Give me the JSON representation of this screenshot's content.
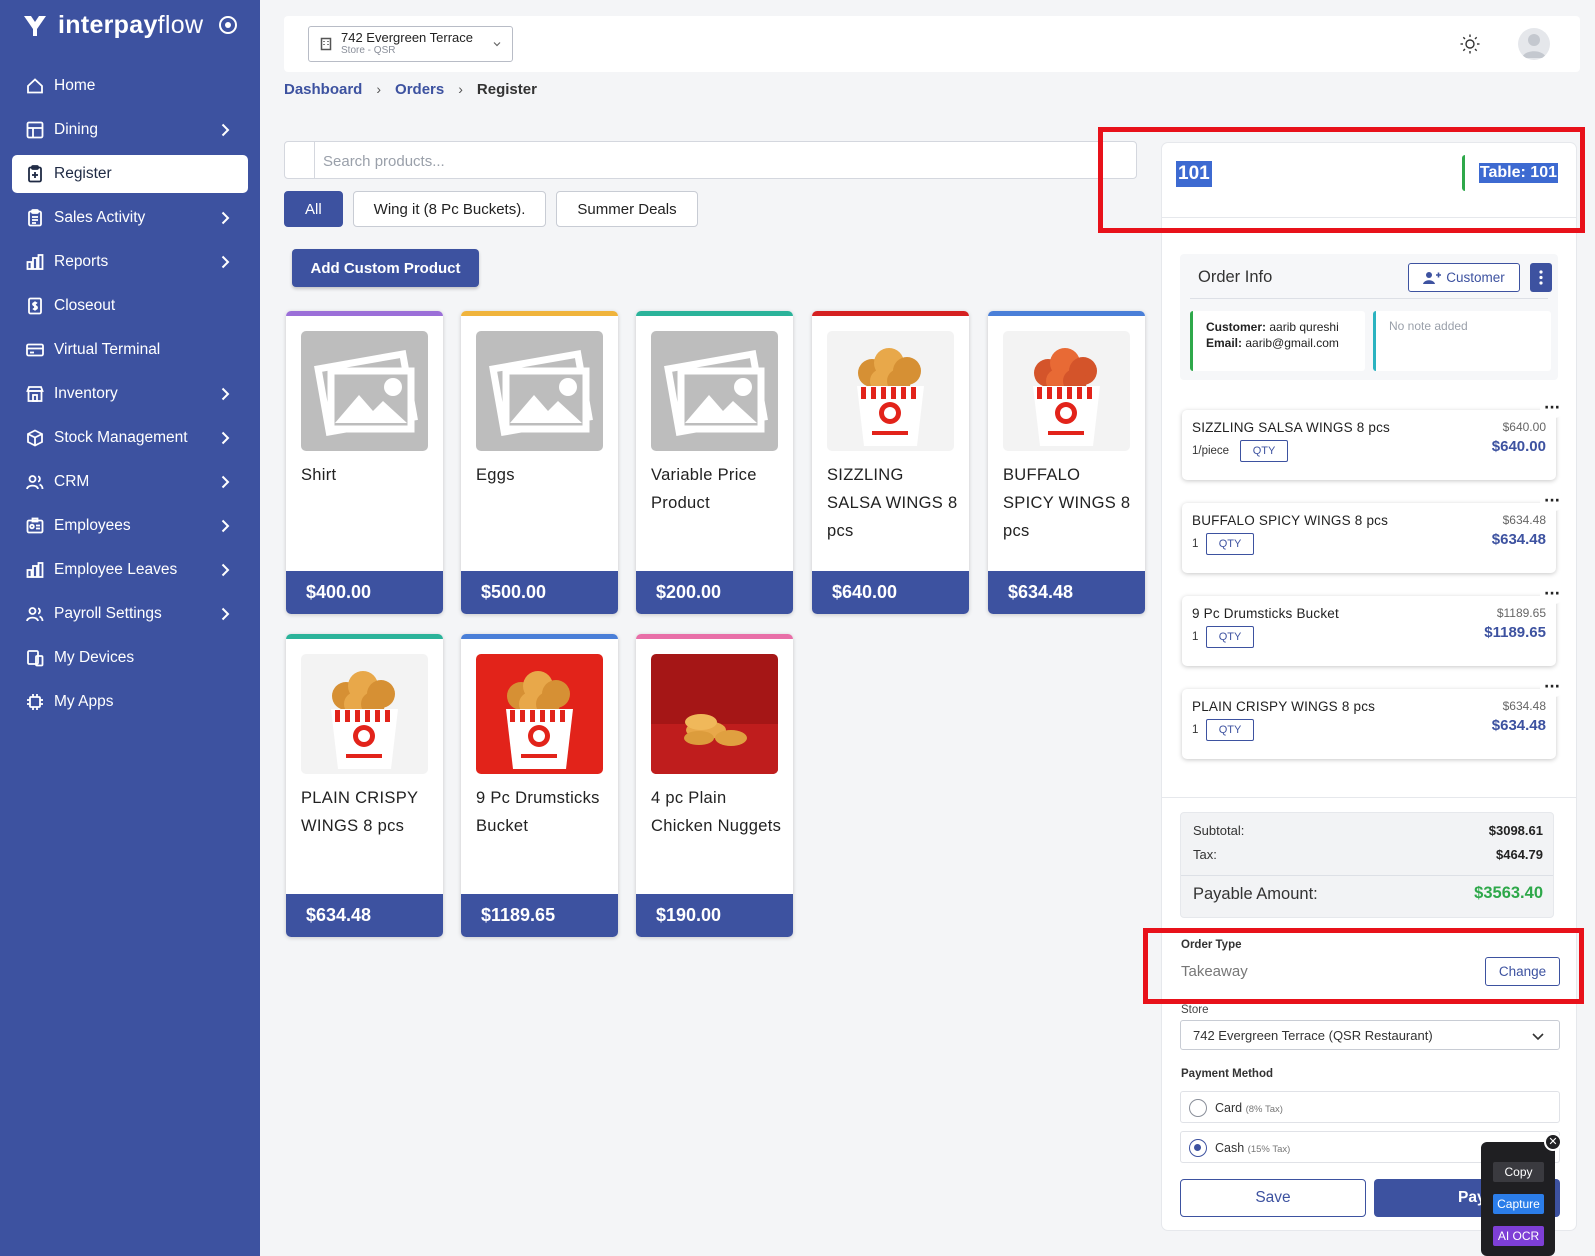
{
  "brand": {
    "name_bold": "interpay",
    "name_light": "flow"
  },
  "sidebar": {
    "items": [
      {
        "label": "Home",
        "icon": "home-icon",
        "has_chevron": false
      },
      {
        "label": "Dining",
        "icon": "table-icon",
        "has_chevron": true
      },
      {
        "label": "Register",
        "icon": "clipboard-icon",
        "has_chevron": false,
        "active": true
      },
      {
        "label": "Sales Activity",
        "icon": "clipboard-list-icon",
        "has_chevron": true
      },
      {
        "label": "Reports",
        "icon": "bar-chart-icon",
        "has_chevron": true
      },
      {
        "label": "Closeout",
        "icon": "dollar-file-icon",
        "has_chevron": false
      },
      {
        "label": "Virtual Terminal",
        "icon": "credit-card-icon",
        "has_chevron": false
      },
      {
        "label": "Inventory",
        "icon": "store-icon",
        "has_chevron": true
      },
      {
        "label": "Stock Management",
        "icon": "box-icon",
        "has_chevron": true
      },
      {
        "label": "CRM",
        "icon": "users-icon",
        "has_chevron": true
      },
      {
        "label": "Employees",
        "icon": "id-card-icon",
        "has_chevron": true
      },
      {
        "label": "Employee Leaves",
        "icon": "bar-chart-icon",
        "has_chevron": true
      },
      {
        "label": "Payroll Settings",
        "icon": "users-icon",
        "has_chevron": true
      },
      {
        "label": "My Devices",
        "icon": "devices-icon",
        "has_chevron": false
      },
      {
        "label": "My Apps",
        "icon": "chip-icon",
        "has_chevron": false
      }
    ]
  },
  "topbar": {
    "store_name": "742 Evergreen Terrace",
    "store_type": "Store - QSR"
  },
  "breadcrumb": {
    "dashboard": "Dashboard",
    "orders": "Orders",
    "current": "Register"
  },
  "search": {
    "placeholder": "Search products..."
  },
  "categories": [
    "All",
    "Wing it (8 Pc Buckets).",
    "Summer Deals"
  ],
  "add_custom_label": "Add Custom Product",
  "products": [
    {
      "name": "Shirt",
      "price": "$400.00",
      "accent": "#9b6fd8",
      "image": "placeholder"
    },
    {
      "name": "Eggs",
      "price": "$500.00",
      "accent": "#f0b43c",
      "image": "placeholder"
    },
    {
      "name": "Variable Price Product",
      "price": "$200.00",
      "accent": "#2bb39a",
      "image": "placeholder"
    },
    {
      "name": "SIZZLING SALSA WINGS 8 pcs",
      "price": "$640.00",
      "accent": "#d52121",
      "image": "bucket-light"
    },
    {
      "name": "BUFFALO SPICY WINGS 8 pcs",
      "price": "$634.48",
      "accent": "#4a7fd8",
      "image": "bucket-spicy"
    },
    {
      "name": "PLAIN CRISPY WINGS 8 pcs",
      "price": "$634.48",
      "accent": "#2bb39a",
      "image": "bucket-light"
    },
    {
      "name": "9 Pc Drumsticks Bucket",
      "price": "$1189.65",
      "accent": "#4a7fd8",
      "image": "bucket-red"
    },
    {
      "name": "4 pc Plain Chicken Nuggets",
      "price": "$190.00",
      "accent": "#e86fa8",
      "image": "nuggets"
    }
  ],
  "table": {
    "number": "101",
    "label": "Table: 101"
  },
  "order_info": {
    "title": "Order Info",
    "customer_btn": "Customer",
    "customer_label": "Customer:",
    "customer_name": "aarib qureshi",
    "email_label": "Email:",
    "email": "aarib@gmail.com",
    "note": "No note added"
  },
  "cart": [
    {
      "name": "SIZZLING SALSA WINGS 8 pcs",
      "unit": "1/piece",
      "qty_label": "QTY",
      "original": "$640.00",
      "price": "$640.00"
    },
    {
      "name": "BUFFALO SPICY WINGS 8 pcs",
      "unit": "1",
      "qty_label": "QTY",
      "original": "$634.48",
      "price": "$634.48"
    },
    {
      "name": "9 Pc Drumsticks Bucket",
      "unit": "1",
      "qty_label": "QTY",
      "original": "$1189.65",
      "price": "$1189.65"
    },
    {
      "name": "PLAIN CRISPY WINGS 8 pcs",
      "unit": "1",
      "qty_label": "QTY",
      "original": "$634.48",
      "price": "$634.48"
    }
  ],
  "summary": {
    "subtotal_label": "Subtotal:",
    "subtotal": "$3098.61",
    "tax_label": "Tax:",
    "tax": "$464.79",
    "payable_label": "Payable Amount:",
    "payable": "$3563.40"
  },
  "order_type": {
    "label": "Order Type",
    "value": "Takeaway",
    "change_btn": "Change"
  },
  "store_field": {
    "label": "Store",
    "value": "742 Evergreen Terrace (QSR Restaurant)"
  },
  "payment": {
    "label": "Payment Method",
    "options": [
      {
        "name": "Card",
        "tax": "(8% Tax)",
        "selected": false
      },
      {
        "name": "Cash",
        "tax": "(15% Tax)",
        "selected": true
      }
    ]
  },
  "actions": {
    "save": "Save",
    "pay": "Pay"
  },
  "ocr_widget": {
    "copy": "Copy",
    "capture": "Capture",
    "ai_ocr": "AI OCR"
  },
  "colors": {
    "primary": "#3d52a0",
    "success": "#2ea84a",
    "highlight": "#e8111a"
  }
}
